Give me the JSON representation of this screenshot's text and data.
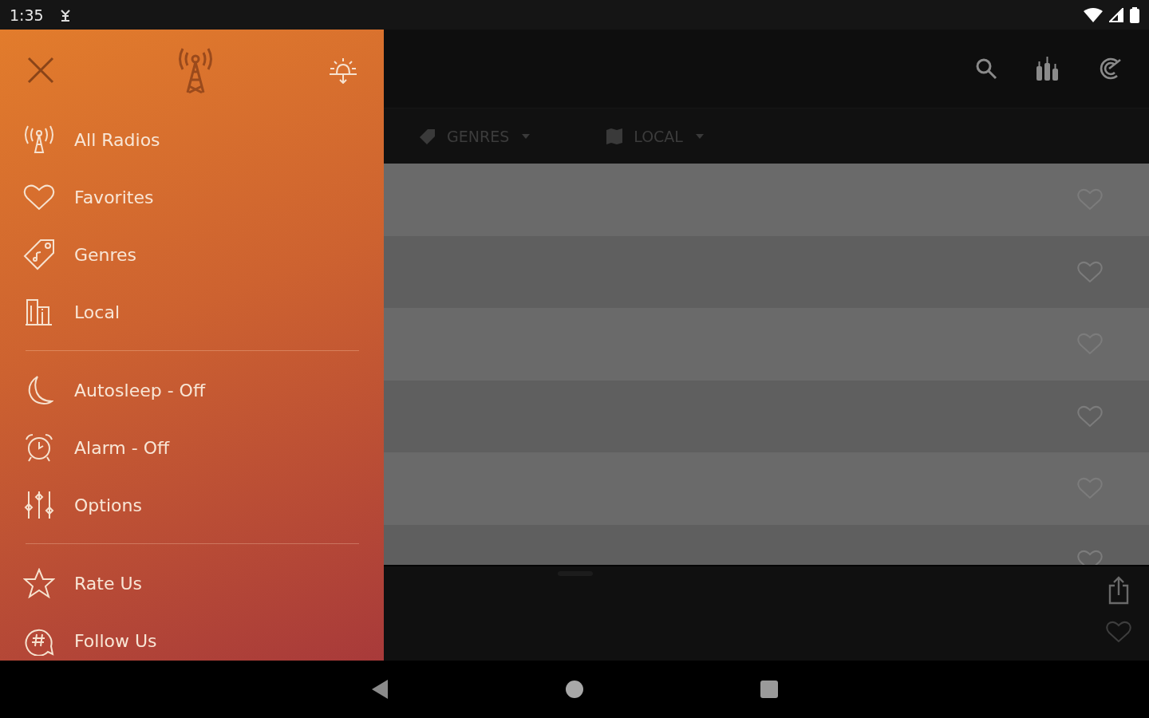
{
  "status_bar": {
    "time": "1:35"
  },
  "drawer": {
    "sections": [
      [
        {
          "label": "All Radios"
        },
        {
          "label": "Favorites"
        },
        {
          "label": "Genres"
        },
        {
          "label": "Local"
        }
      ],
      [
        {
          "label": "Autosleep - Off"
        },
        {
          "label": "Alarm - Off"
        },
        {
          "label": "Options"
        }
      ],
      [
        {
          "label": "Rate Us"
        },
        {
          "label": "Follow Us"
        }
      ]
    ]
  },
  "filters": [
    {
      "label": "GENRES"
    },
    {
      "label": "LOCAL"
    }
  ],
  "station_rows": [
    {
      "favorite": false
    },
    {
      "favorite": false
    },
    {
      "favorite": false
    },
    {
      "favorite": false
    },
    {
      "favorite": false
    },
    {
      "favorite": false
    }
  ],
  "player": {
    "favorite": false
  }
}
